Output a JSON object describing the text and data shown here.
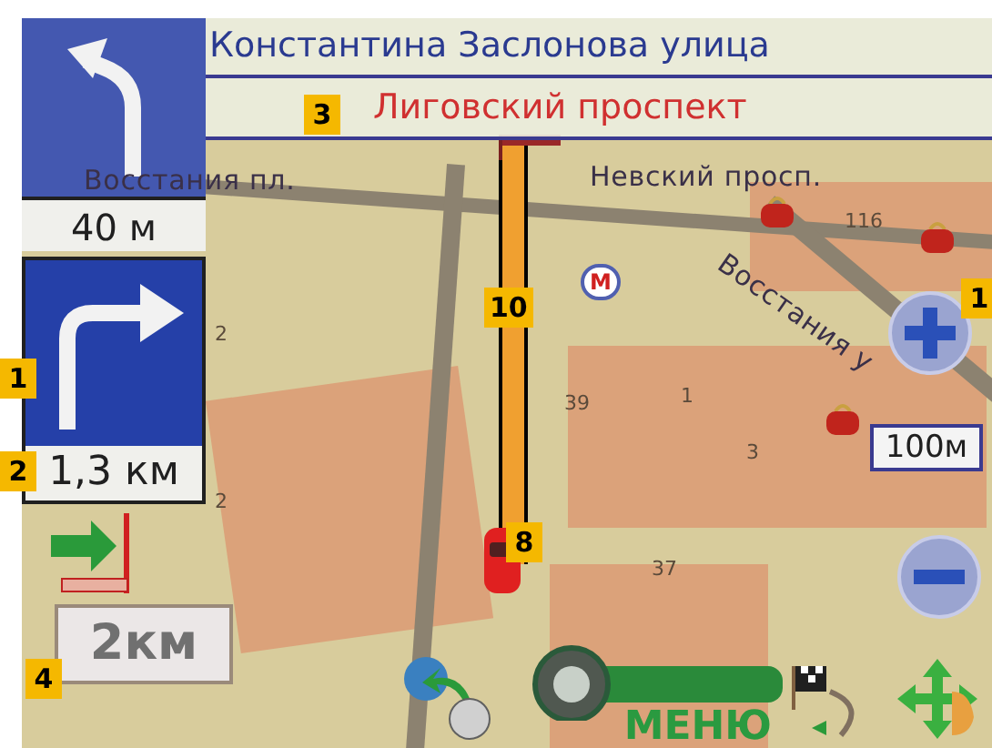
{
  "maneuvers": [
    {
      "kind": "left",
      "distance": "40 м"
    },
    {
      "kind": "right",
      "distance": "1,3 км"
    }
  ],
  "street_current": "Константина Заслонова улица",
  "street_next": "Лиговский проспект",
  "map_labels": [
    {
      "kind": "street",
      "text": "Восстания пл."
    },
    {
      "kind": "street",
      "text": "Невский просп."
    },
    {
      "kind": "number",
      "text": "116"
    },
    {
      "kind": "street-diagonal",
      "text": "Восстания у"
    },
    {
      "kind": "number",
      "text": "2"
    },
    {
      "kind": "number",
      "text": "39"
    },
    {
      "kind": "number",
      "text": "1"
    },
    {
      "kind": "number",
      "text": "3"
    },
    {
      "kind": "number",
      "text": "2"
    },
    {
      "kind": "number",
      "text": "37"
    }
  ],
  "metro_sign": "М",
  "scale_label": "100м",
  "range_label": "2км",
  "menu_label": "МЕНЮ",
  "callouts": [
    {
      "number": "3"
    },
    {
      "number": "10"
    },
    {
      "number": "1"
    },
    {
      "number": "1"
    },
    {
      "number": "2"
    },
    {
      "number": "8"
    },
    {
      "number": "4"
    }
  ]
}
